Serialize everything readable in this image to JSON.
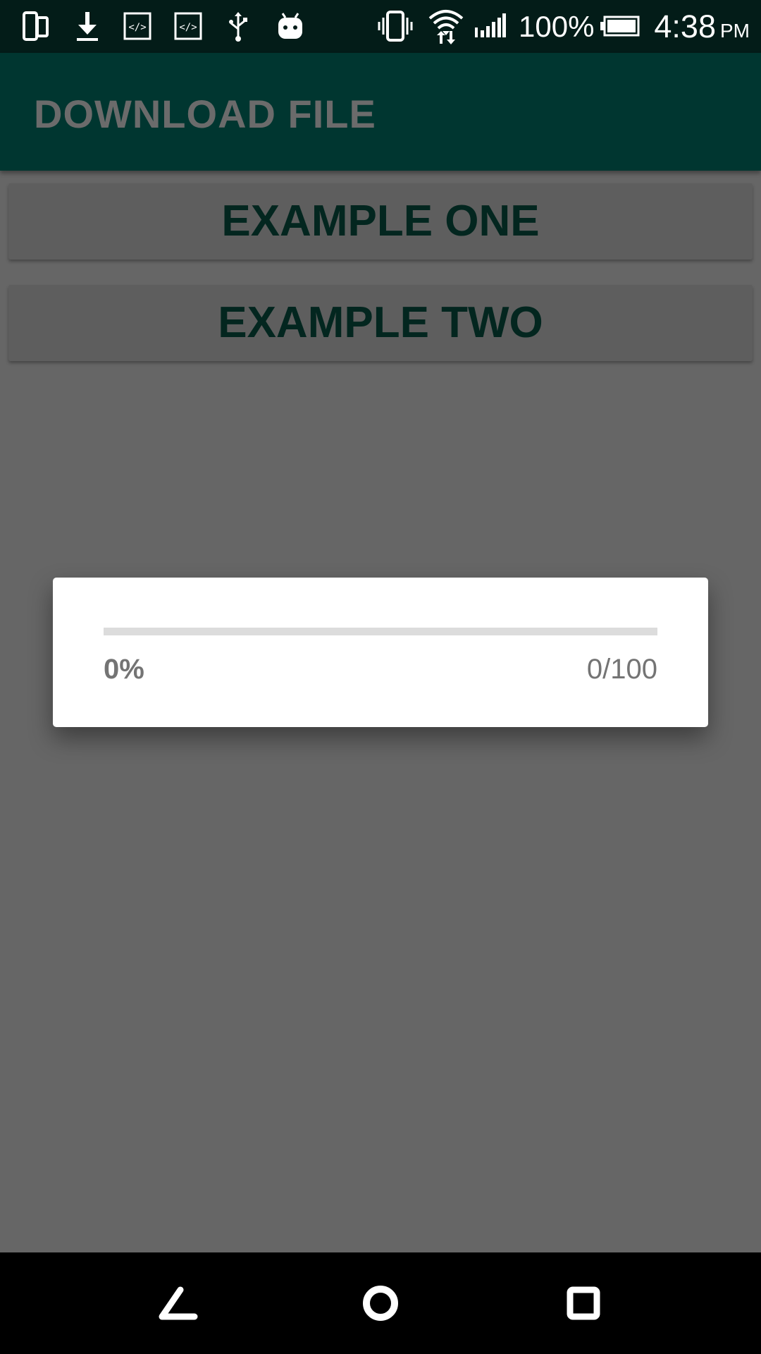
{
  "status_bar": {
    "icons": [
      "phone-screens-icon",
      "download-icon",
      "code-icon",
      "code-icon",
      "usb-icon",
      "android-debug-icon",
      "vibrate-icon",
      "wifi-icon",
      "signal-icon",
      "battery-icon"
    ],
    "battery_text": "100%",
    "time": "4:38",
    "ampm": "PM"
  },
  "app_bar": {
    "title": "DOWNLOAD FILE"
  },
  "buttons": {
    "example_one": "EXAMPLE ONE",
    "example_two": "EXAMPLE TWO"
  },
  "dialog": {
    "progress_percent_label": "0%",
    "progress_count_label": "0/100",
    "progress_value": 0,
    "progress_max": 100
  },
  "nav_bar": {
    "icons": [
      "back-icon",
      "home-icon",
      "recents-icon"
    ]
  },
  "colors": {
    "status_bar": "#031c18",
    "app_bar": "#003630",
    "scrim_background": "#666666",
    "button_text": "#03261f",
    "progress_track": "#dcdcdc"
  }
}
